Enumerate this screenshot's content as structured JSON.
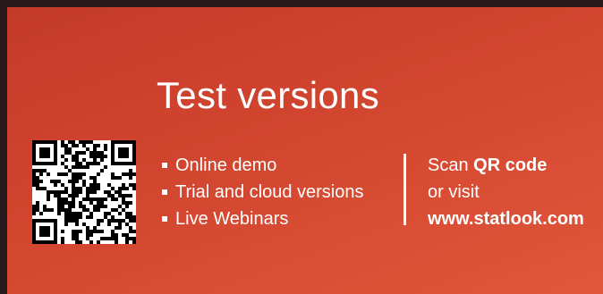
{
  "title": "Test versions",
  "bullets": [
    "Online demo",
    "Trial and cloud versions",
    "Live Webinars"
  ],
  "scan": {
    "prefix": "Scan",
    "qr": "QR code",
    "or_visit": "or visit",
    "url": "www.statlook.com"
  },
  "colors": {
    "background": "#d2452f",
    "text": "#ffffff"
  }
}
